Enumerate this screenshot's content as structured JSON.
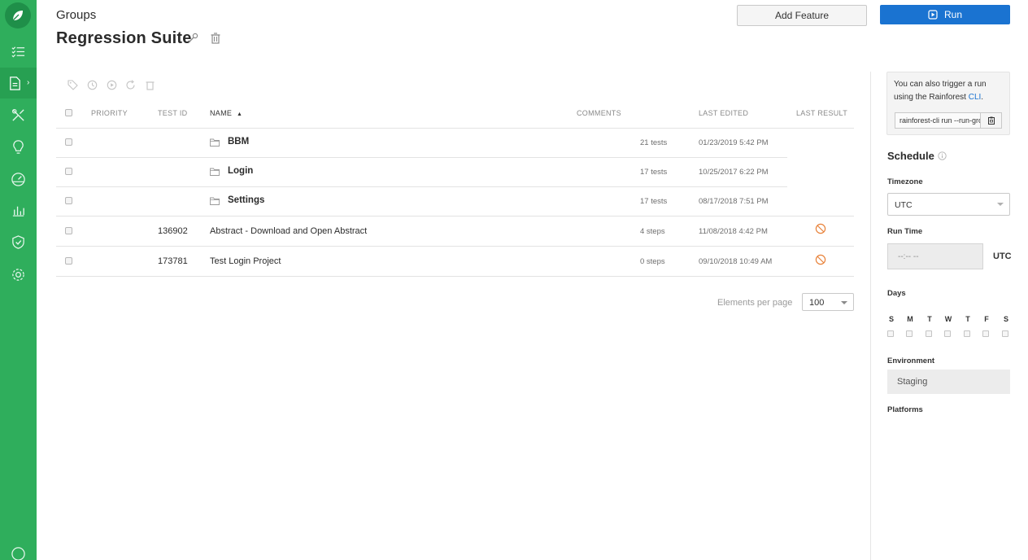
{
  "colors": {
    "sidebar": "#2fae5c",
    "primary": "#1a73d1",
    "warning": "#e8823a"
  },
  "sidebar": {
    "items": [
      {
        "name": "checklist-icon"
      },
      {
        "name": "document-icon",
        "active": true
      },
      {
        "name": "tools-icon"
      },
      {
        "name": "lightbulb-icon"
      },
      {
        "name": "dashboard-icon"
      },
      {
        "name": "bar-chart-icon"
      },
      {
        "name": "shield-check-icon"
      },
      {
        "name": "gear-icon"
      }
    ]
  },
  "header": {
    "breadcrumb": "Groups",
    "title": "Regression Suite",
    "add_feature_label": "Add Feature",
    "run_label": "Run"
  },
  "toolbar": {
    "icons": [
      "tag-icon",
      "clock-icon",
      "play-circle-icon",
      "refresh-icon",
      "trash-icon"
    ]
  },
  "table": {
    "columns": [
      "PRIORITY",
      "TEST ID",
      "NAME",
      "COMMENTS",
      "LAST EDITED",
      "LAST RESULT"
    ],
    "folders": [
      {
        "name": "BBM",
        "count": "21 tests",
        "edited": "01/23/2019 5:42 PM"
      },
      {
        "name": "Login",
        "count": "17 tests",
        "edited": "10/25/2017 6:22 PM"
      },
      {
        "name": "Settings",
        "count": "17 tests",
        "edited": "08/17/2018 7:51 PM"
      }
    ],
    "tests": [
      {
        "id": "136902",
        "name": "Abstract - Download and Open Abstract",
        "steps": "4 steps",
        "edited": "11/08/2018 4:42 PM",
        "result": "no-result-icon"
      },
      {
        "id": "173781",
        "name": "Test Login Project",
        "steps": "0 steps",
        "edited": "09/10/2018 10:49 AM",
        "result": "no-result-icon"
      }
    ]
  },
  "pagination": {
    "label": "Elements per page",
    "value": "100"
  },
  "right_panel": {
    "cli_text_1": "You can also trigger a run using the Rainforest ",
    "cli_link": "CLI",
    "cli_text_2": ".",
    "cli_command": "rainforest-cli run --run-group",
    "schedule_title": "Schedule",
    "timezone_label": "Timezone",
    "timezone_value": "UTC",
    "run_time_label": "Run Time",
    "run_time_placeholder": "--:-- --",
    "run_time_unit": "UTC",
    "days_label": "Days",
    "days": [
      "S",
      "M",
      "T",
      "W",
      "T",
      "F",
      "S"
    ],
    "environment_label": "Environment",
    "environment_value": "Staging",
    "platforms_label": "Platforms"
  }
}
